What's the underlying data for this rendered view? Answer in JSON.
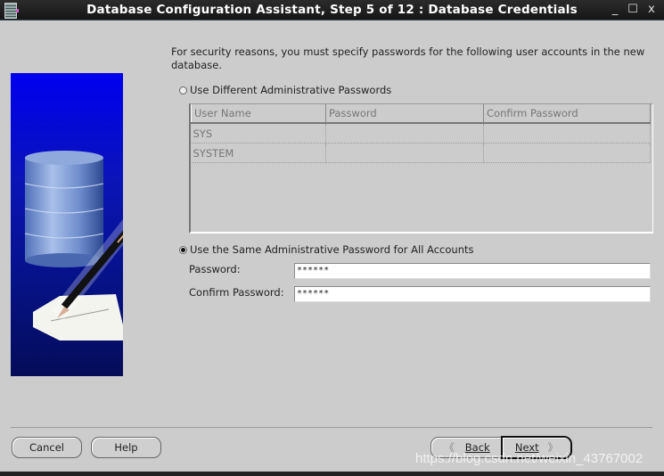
{
  "window": {
    "title": "Database Configuration Assistant, Step 5 of 12 : Database Credentials",
    "controls": {
      "minimize": "_",
      "maximize": "☐",
      "close": "x"
    }
  },
  "intro_text": "For security reasons, you must specify passwords for the following user accounts in the new database.",
  "options": {
    "different": {
      "label": "Use Different Administrative Passwords",
      "selected": false
    },
    "same": {
      "label": "Use the Same Administrative Password for All Accounts",
      "selected": true
    }
  },
  "accounts_table": {
    "columns": [
      "User Name",
      "Password",
      "Confirm Password"
    ],
    "rows": [
      {
        "user": "SYS",
        "password": "",
        "confirm": ""
      },
      {
        "user": "SYSTEM",
        "password": "",
        "confirm": ""
      }
    ]
  },
  "same_password": {
    "password_label": "Password:",
    "password_value": "******",
    "confirm_label": "Confirm Password:",
    "confirm_value": "******"
  },
  "buttons": {
    "cancel": "Cancel",
    "help": "Help",
    "back": "Back",
    "next": "Next",
    "back_arrow": "《",
    "next_arrow": "》"
  },
  "watermark": "https://blog.csdn.net/weixin_43767002"
}
